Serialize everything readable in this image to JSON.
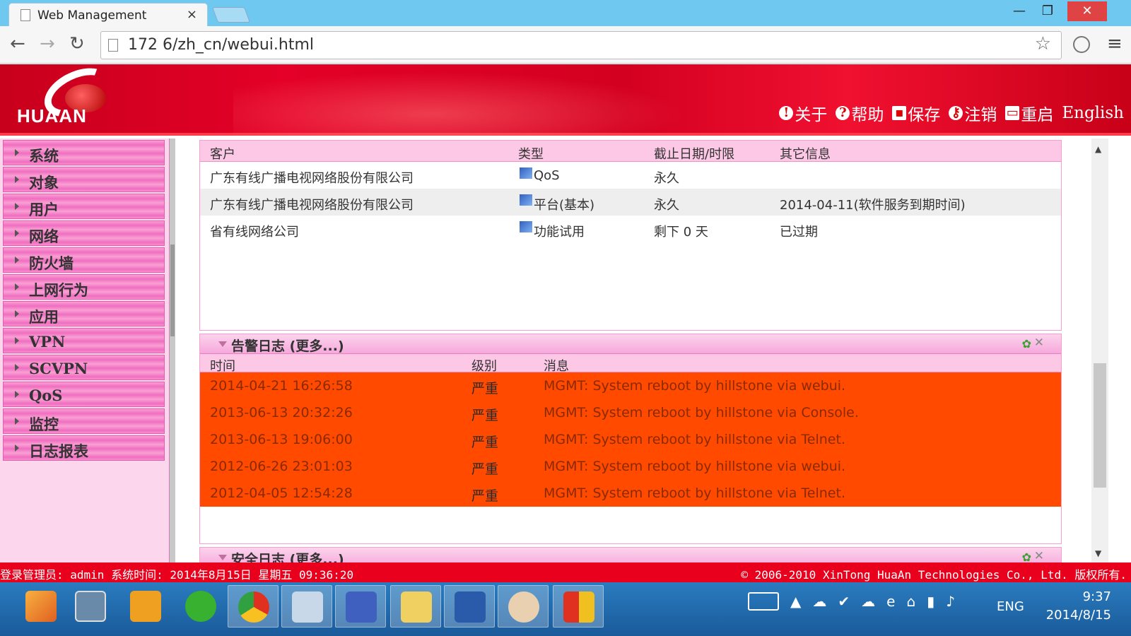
{
  "browser": {
    "tab_title": "Web Management",
    "tab_close": "×",
    "url": "172        6/zh_cn/webui.html",
    "win_min": "—",
    "win_max": "❐",
    "win_close": "✕"
  },
  "header": {
    "logo_text": "HUAAN",
    "links": [
      {
        "icon": "!",
        "label": "关于"
      },
      {
        "icon": "?",
        "label": "帮助"
      },
      {
        "icon": "▪",
        "label": "保存"
      },
      {
        "icon": "⚷",
        "label": "注销"
      },
      {
        "icon": "▭",
        "label": "重启"
      },
      {
        "icon": "",
        "label": "English"
      }
    ]
  },
  "sidebar": {
    "items": [
      "系统",
      "对象",
      "用户",
      "网络",
      "防火墙",
      "上网行为",
      "应用",
      "VPN",
      "SCVPN",
      "QoS",
      "监控",
      "日志报表"
    ]
  },
  "license": {
    "headers": [
      "客户",
      "类型",
      "截止日期/时限",
      "其它信息"
    ],
    "rows": [
      {
        "customer": "广东有线广播电视网络股份有限公司",
        "type": "QoS",
        "expire": "永久",
        "info": ""
      },
      {
        "customer": "广东有线广播电视网络股份有限公司",
        "type": "平台(基本)",
        "expire": "永久",
        "info": "2014-04-11(软件服务到期时间)"
      },
      {
        "customer": "省有线网络公司",
        "type": "功能试用",
        "expire": "剩下 0 天",
        "info": "已过期"
      }
    ]
  },
  "alarm_log": {
    "title": "告警日志 (更多...)",
    "headers": [
      "时间",
      "级别",
      "消息"
    ],
    "rows": [
      {
        "time": "2014-04-21 16:26:58",
        "level": "严重",
        "msg": "MGMT: System reboot by hillstone via webui."
      },
      {
        "time": "2013-06-13 20:32:26",
        "level": "严重",
        "msg": "MGMT: System reboot by hillstone via Console."
      },
      {
        "time": "2013-06-13 19:06:00",
        "level": "严重",
        "msg": "MGMT: System reboot by hillstone via Telnet."
      },
      {
        "time": "2012-06-26 23:01:03",
        "level": "严重",
        "msg": "MGMT: System reboot by hillstone via webui."
      },
      {
        "time": "2012-04-05 12:54:28",
        "level": "严重",
        "msg": "MGMT: System reboot by hillstone via Telnet."
      }
    ]
  },
  "security_log": {
    "title": "安全日志 (更多...)"
  },
  "status_bar": {
    "left": "登录管理员: admin 系统时间: 2014年8月15日 星期五 09:36:20",
    "right": "© 2006-2010 XinTong HuaAn Technologies Co., Ltd. 版权所有."
  },
  "taskbar": {
    "eng": "ENG",
    "time": "9:37",
    "date": "2014/8/15"
  },
  "colors": {
    "banner": "#d40020",
    "alarm_row": "#ff4a00",
    "sidebar_item": "#f06ec0"
  }
}
